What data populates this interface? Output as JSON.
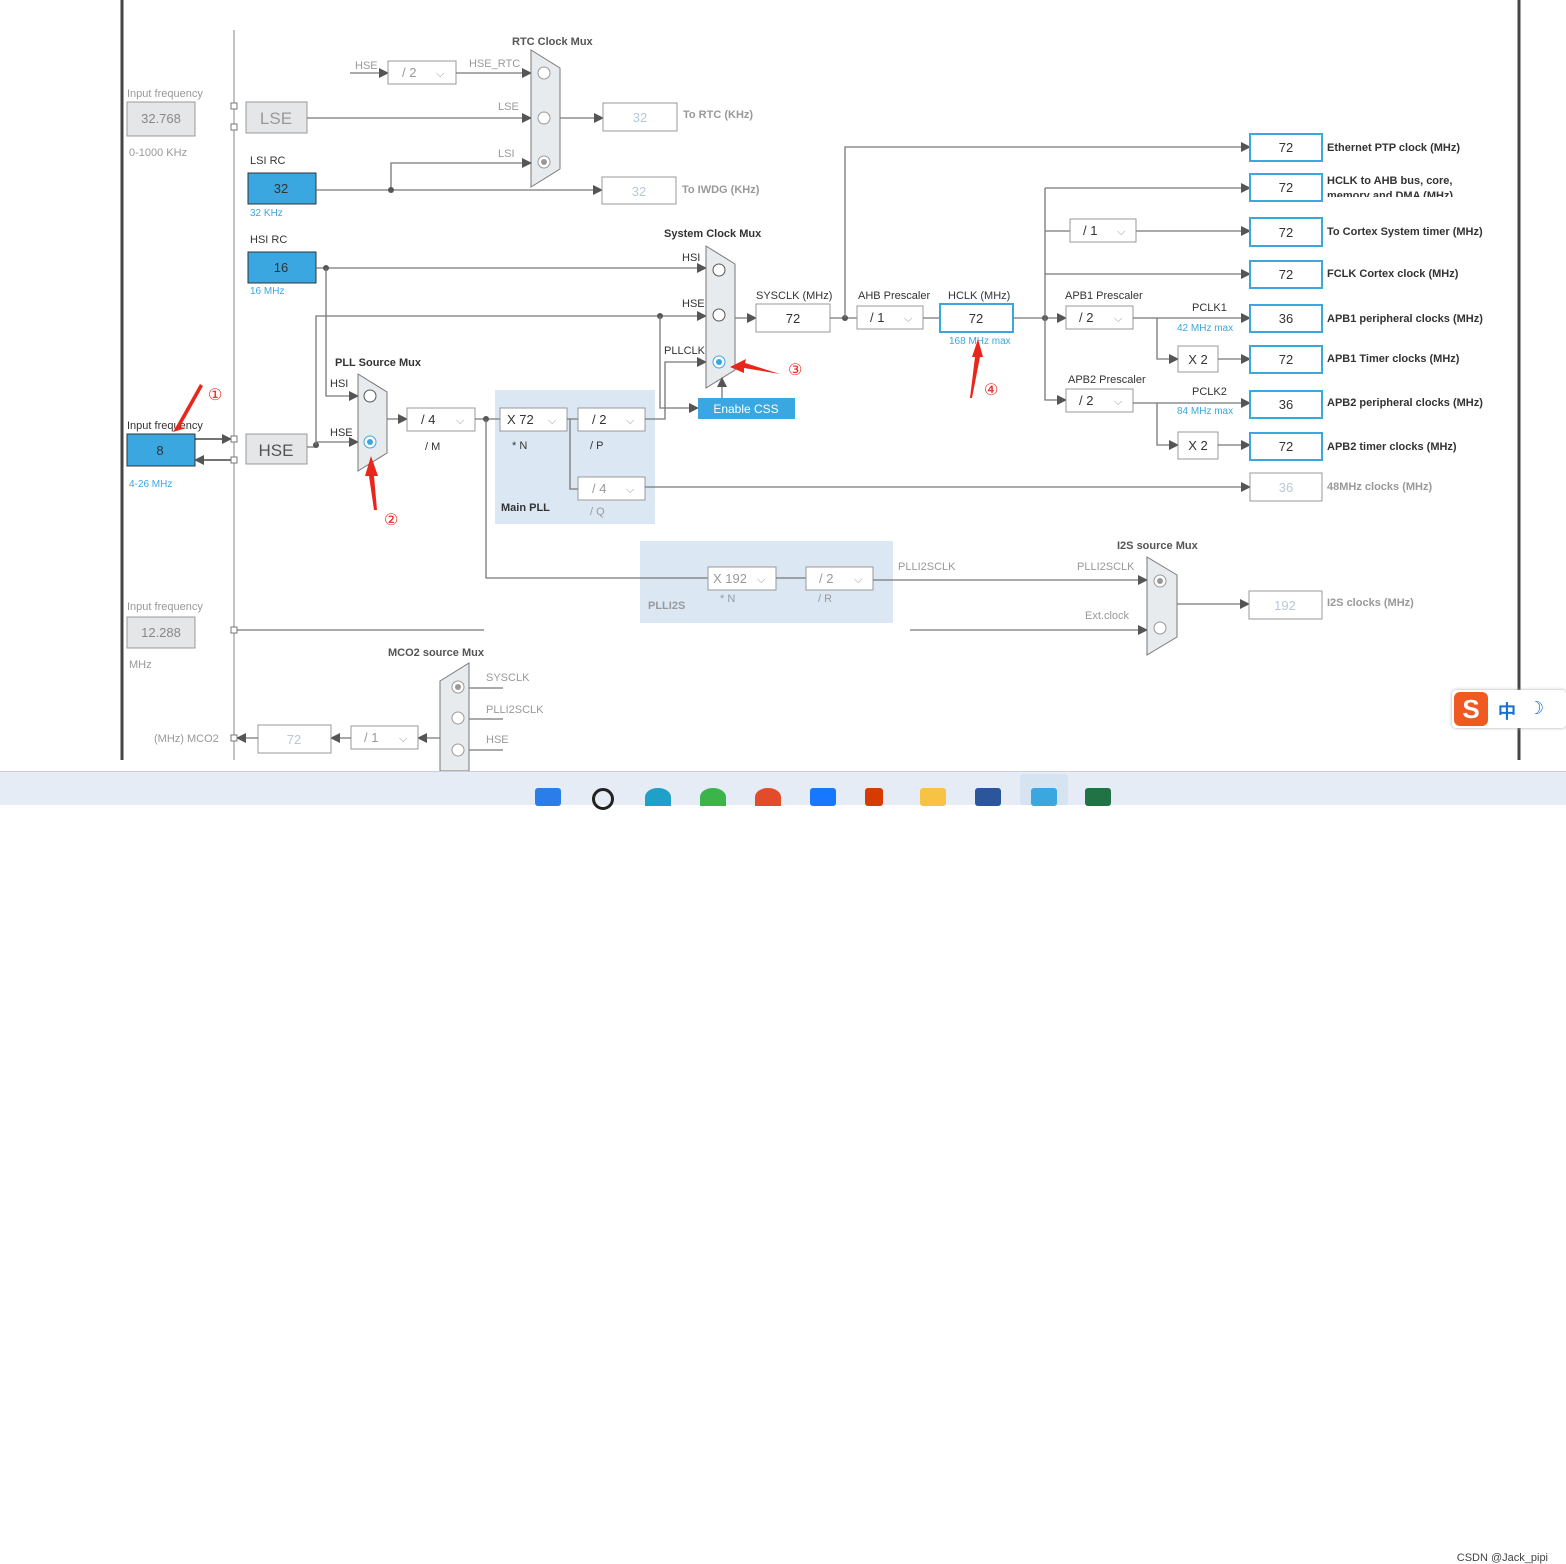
{
  "lse": {
    "input_label": "Input frequency",
    "input_value": "32.768",
    "range": "0-1000 KHz",
    "name": "LSE"
  },
  "lsi": {
    "title": "LSI RC",
    "value": "32",
    "unit": "32 KHz"
  },
  "hsi": {
    "title": "HSI RC",
    "value": "16",
    "unit": "16 MHz"
  },
  "hse": {
    "input_label": "Input frequency",
    "input_value": "8",
    "range": "4-26 MHz",
    "name": "HSE"
  },
  "i2s_ext": {
    "input_label": "Input frequency",
    "input_value": "12.288",
    "unit": "MHz"
  },
  "rtc_mux": {
    "title": "RTC Clock Mux",
    "hse_label": "HSE",
    "div": "/ 2",
    "hse_rtc": "HSE_RTC",
    "lse": "LSE",
    "lsi": "LSI",
    "selected": "LSI",
    "rtc_value": "32",
    "rtc_label": "To RTC (KHz)",
    "iwdg_value": "32",
    "iwdg_label": "To IWDG (KHz)"
  },
  "pll_mux": {
    "title": "PLL Source Mux",
    "hsi": "HSI",
    "hse": "HSE",
    "selected": "HSE"
  },
  "main_pll": {
    "title": "Main PLL",
    "m": "/ 4",
    "m_label": "/ M",
    "n": "X 72",
    "n_label": "* N",
    "p": "/ 2",
    "p_label": "/ P",
    "q": "/ 4",
    "q_label": "/ Q"
  },
  "sys_mux": {
    "title": "System Clock Mux",
    "hsi": "HSI",
    "hse": "HSE",
    "pllclk": "PLLCLK",
    "selected": "PLLCLK",
    "css_button": "Enable CSS"
  },
  "sysclk": {
    "label": "SYSCLK (MHz)",
    "value": "72"
  },
  "ahb": {
    "label": "AHB Prescaler",
    "value": "/ 1"
  },
  "hclk": {
    "label": "HCLK (MHz)",
    "value": "72",
    "max": "168 MHz max"
  },
  "cortex_div": "/ 1",
  "apb1": {
    "label": "APB1 Prescaler",
    "value": "/ 2",
    "pclk": "PCLK1",
    "max": "42 MHz max",
    "mult": "X 2"
  },
  "apb2": {
    "label": "APB2 Prescaler",
    "value": "/ 2",
    "pclk": "PCLK2",
    "max": "84 MHz max",
    "mult": "X 2"
  },
  "outputs": [
    {
      "value": "72",
      "label": "Ethernet PTP clock (MHz)"
    },
    {
      "value": "72",
      "label": "HCLK to AHB bus, core,",
      "label2": "memory and DMA (MHz)"
    },
    {
      "value": "72",
      "label": "To Cortex System timer (MHz)"
    },
    {
      "value": "72",
      "label": "FCLK Cortex clock (MHz)"
    },
    {
      "value": "36",
      "label": "APB1 peripheral clocks (MHz)"
    },
    {
      "value": "72",
      "label": "APB1 Timer clocks (MHz)"
    },
    {
      "value": "36",
      "label": "APB2 peripheral clocks (MHz)"
    },
    {
      "value": "72",
      "label": "APB2 timer clocks (MHz)"
    },
    {
      "value": "36",
      "label": "48MHz clocks (MHz)"
    }
  ],
  "plli2s": {
    "title": "PLLI2S",
    "n": "X 192",
    "n_label": "* N",
    "r": "/ 2",
    "r_label": "/ R",
    "out": "PLLI2SCLK"
  },
  "i2s_mux": {
    "title": "I2S source Mux",
    "in1": "PLLI2SCLK",
    "in2": "Ext.clock",
    "selected": "PLLI2SCLK",
    "value": "192",
    "label": "I2S clocks (MHz)"
  },
  "mco2": {
    "title": "MCO2 source Mux",
    "in1": "SYSCLK",
    "in2": "PLLI2SCLK",
    "in3": "HSE",
    "selected": "SYSCLK",
    "div": "/ 1",
    "value": "72",
    "label": "(MHz) MCO2"
  },
  "annotations": [
    "①",
    "②",
    "③",
    "④"
  ],
  "colors": {
    "accent": "#3aa7e0",
    "annotation": "#e8261c",
    "panel": "#dbe8f4"
  },
  "ime": {
    "logo": "S",
    "mode": "中",
    "moon": "☽"
  },
  "watermark": "CSDN @Jack_pipi"
}
